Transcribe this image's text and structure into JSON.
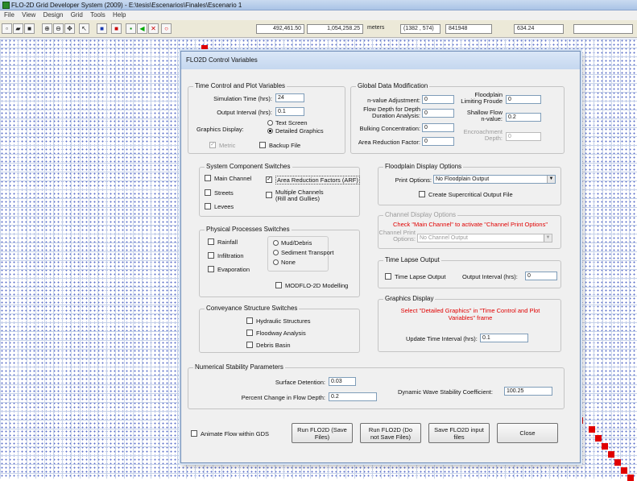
{
  "window": {
    "title": "FLO-2D Grid Developer System (2009) - E:\\tesis\\Escenarios\\Finales\\Escenario 1"
  },
  "menu": [
    "File",
    "View",
    "Design",
    "Grid",
    "Tools",
    "Help"
  ],
  "toolbar": {
    "icons": [
      "new",
      "open",
      "save",
      "zoom-in",
      "zoom-out",
      "pan",
      "pointer",
      "grid",
      "node",
      "add",
      "delete",
      "cancel",
      "circle"
    ],
    "x_coord": "492,461.50",
    "y_coord": "1,054,258.25",
    "units": "meters",
    "cell_pos": "(1382 , 574)",
    "cell_id": "841948",
    "elevation": "634.24"
  },
  "dialog": {
    "title": "FLO2D Control Variables",
    "time_control": {
      "title": "Time Control and Plot Variables",
      "sim_time_label": "Simulation Time (hrs):",
      "sim_time": "24",
      "output_interval_label": "Output Interval (hrs):",
      "output_interval": "0.1",
      "graphics_display_label": "Graphics Display:",
      "text_screen": "Text Screen",
      "detailed_graphics": "Detailed Graphics",
      "metric": "Metric",
      "backup": "Backup File"
    },
    "global_mod": {
      "title": "Global Data Modification",
      "n_value_label": "n-value Adjustment:",
      "n_value": "0",
      "flow_depth_label": "Flow Depth for Depth\nDuration Analysis:",
      "flow_depth": "0",
      "bulking_label": "Bulking Concentration:",
      "bulking": "0",
      "area_red_label": "Area Reduction Factor:",
      "area_red": "0",
      "froude_label": "Floodplain\nLimiting Froude",
      "froude": "0",
      "shallow_label": "Shallow Flow\nn-value:",
      "shallow": "0.2",
      "encroach_label": "Encroachment\nDepth:",
      "encroach": "0"
    },
    "system_switches": {
      "title": "System Component Switches",
      "main_channel": "Main Channel",
      "arf": "Area Reduction Factors (ARF)",
      "streets": "Streets",
      "multiple": "Multiple Channels\n(Rill and Gullies)",
      "levees": "Levees"
    },
    "physical": {
      "title": "Physical Processes Switches",
      "rainfall": "Rainfall",
      "infiltration": "Infiltration",
      "evaporation": "Evaporation",
      "mud": "Mud/Debris",
      "sediment": "Sediment Transport",
      "none": "None",
      "modflo": "MODFLO-2D Modelling"
    },
    "conveyance": {
      "title": "Conveyance Structure Switches",
      "hydraulic": "Hydraulic Structures",
      "floodway": "Floodway Analysis",
      "debris": "Debris Basin"
    },
    "floodplain": {
      "title": "Floodplain Display Options",
      "print_label": "Print Options:",
      "print_value": "No Floodplain Output",
      "supercritical": "Create Supercritical Output File"
    },
    "channel": {
      "title": "Channel Display Options",
      "warning": "Check \"Main Channel\" to activate \"Channel Print Options\"",
      "print_label": "Channel Print\nOptions:",
      "print_value": "No Channel Output"
    },
    "time_lapse": {
      "title": "Time Lapse Output",
      "check": "Time Lapse Output",
      "interval_label": "Output Interval (hrs):",
      "interval": "0"
    },
    "graphics": {
      "title": "Graphics Display",
      "warning": "Select \"Detailed Graphics\" in \"Time Control and Plot\nVariables\" frame",
      "update_label": "Update Time Interval (hrs):",
      "update": "0.1"
    },
    "numerical": {
      "title": "Numerical Stability Parameters",
      "surface_label": "Surface Detention:",
      "surface": "0.03",
      "percent_label": "Percent Change in Flow Depth:",
      "percent": "0.2",
      "dynamic_label": "Dynamic Wave Stability Coefficient:",
      "dynamic": "100.25"
    },
    "buttons": {
      "animate": "Animate Flow within GDS",
      "run_save": "Run FLO2D  (Save\nFiles)",
      "run_nosave": "Run FLO2D   (Do\nnot Save Files)",
      "save_inputs": "Save FLO2D  input\nfiles",
      "close": "Close"
    }
  }
}
